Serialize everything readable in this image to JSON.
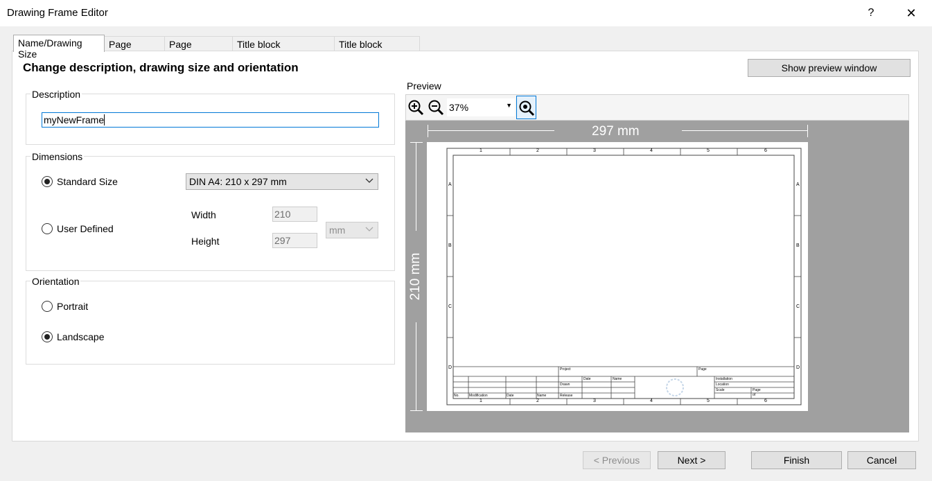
{
  "window": {
    "title": "Drawing Frame Editor",
    "help": "?",
    "close": "✕"
  },
  "tabs": [
    "Name/Drawing Size",
    "Page border",
    "Page Dividers",
    "Title block customizing",
    "Title block location"
  ],
  "heading": "Change description, drawing size and orientation",
  "show_preview_label": "Show preview window",
  "description": {
    "legend": "Description",
    "value": "myNewFrame"
  },
  "dimensions": {
    "legend": "Dimensions",
    "standard_label": "Standard Size",
    "standard_value": "DIN A4: 210 x 297 mm",
    "user_label": "User Defined",
    "width_label": "Width",
    "width_value": "210",
    "height_label": "Height",
    "height_value": "297",
    "unit": "mm"
  },
  "orientation": {
    "legend": "Orientation",
    "portrait": "Portrait",
    "landscape": "Landscape",
    "selected": "Landscape"
  },
  "preview": {
    "label": "Preview",
    "zoom": "37%",
    "width_dim": "297 mm",
    "height_dim": "210 mm",
    "columns": [
      "1",
      "2",
      "3",
      "4",
      "5",
      "6"
    ],
    "rows": [
      "A",
      "B",
      "C",
      "D"
    ],
    "title_block": {
      "project": "Project",
      "page": "Page",
      "date": "Date",
      "name": "Name",
      "drawn": "Drawn",
      "installation": "Installation",
      "location": "Location",
      "scale": "Scale",
      "page2": "Page",
      "of": "of",
      "no": "No.",
      "modification": "Modification",
      "date2": "Date",
      "name2": "Name",
      "release": "Release"
    }
  },
  "footer": {
    "previous": "< Previous",
    "next": "Next >",
    "finish": "Finish",
    "cancel": "Cancel"
  }
}
